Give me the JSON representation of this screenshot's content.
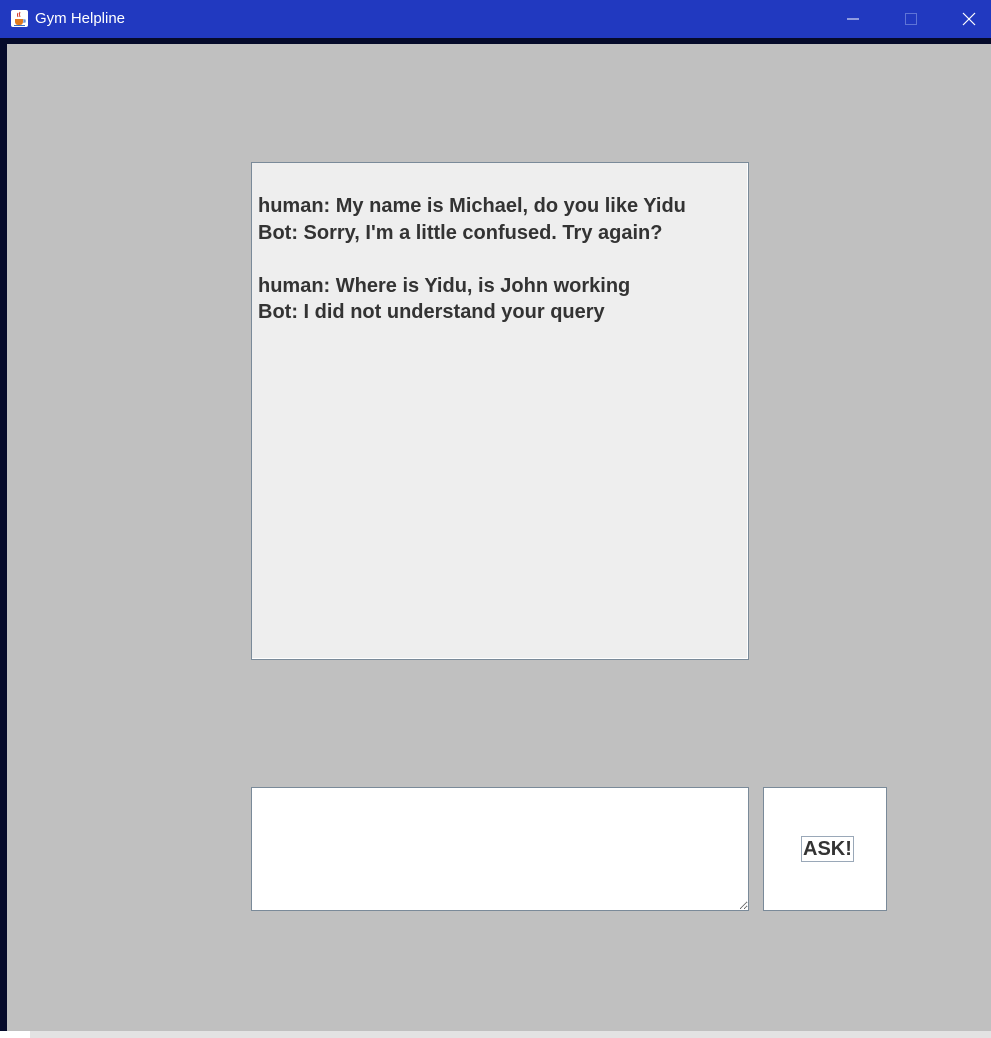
{
  "window": {
    "title": "Gym Helpline",
    "icon": "java-cup-icon",
    "controls": [
      "minimize-icon",
      "maximize-icon",
      "close-icon"
    ]
  },
  "chat": {
    "lines": [
      "human: My name is Michael, do you like Yidu",
      "Bot: Sorry, I'm a little confused. Try again?",
      "",
      "human: Where is Yidu, is John working",
      "Bot: I did not understand your query"
    ]
  },
  "input": {
    "value": "",
    "placeholder": ""
  },
  "ask_button": {
    "label": "ASK!"
  },
  "colors": {
    "titlebar": "#2139c0",
    "background": "#c0c0c0",
    "chat_background": "#eeeeee",
    "text": "#333333"
  }
}
